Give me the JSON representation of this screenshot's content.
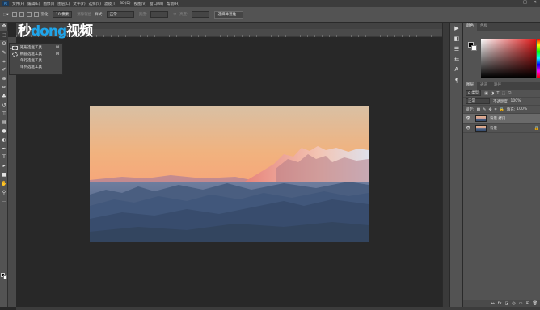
{
  "menubar": {
    "logo": "Ps",
    "items": [
      "文件(F)",
      "编辑(E)",
      "图像(I)",
      "图层(L)",
      "文字(Y)",
      "选择(S)",
      "滤镜(T)",
      "3D(D)",
      "视图(V)",
      "窗口(W)",
      "帮助(H)"
    ],
    "window_controls": [
      "—",
      "□",
      "✕"
    ]
  },
  "options_bar": {
    "feather_label": "羽化:",
    "feather_value": "10 像素",
    "antialias_label": "消除锯齿",
    "style_label": "样式:",
    "style_value": "正常",
    "width_label": "宽度:",
    "height_label": "高度:",
    "select_mask_button": "选择并遮住..."
  },
  "watermark": {
    "part1": "秒",
    "part2": "dong",
    "part3": "视频"
  },
  "flyout": {
    "items": [
      {
        "label": "矩形选框工具",
        "key": "M"
      },
      {
        "label": "椭圆选框工具",
        "key": "M"
      },
      {
        "label": "单行选框工具",
        "key": ""
      },
      {
        "label": "单列选框工具",
        "key": ""
      }
    ]
  },
  "toolbar": {
    "icons": [
      "move-icon",
      "marquee-icon",
      "lasso-icon",
      "quick-select-icon",
      "crop-icon",
      "eyedropper-icon",
      "healing-icon",
      "brush-icon",
      "stamp-icon",
      "history-brush-icon",
      "eraser-icon",
      "gradient-icon",
      "blur-icon",
      "dodge-icon",
      "pen-icon",
      "type-icon",
      "path-select-icon",
      "shape-icon",
      "hand-icon",
      "zoom-icon",
      "more-icon"
    ],
    "glyphs": [
      "✥",
      "⬚",
      "ʘ",
      "✎",
      "⌗",
      "✐",
      "⊕",
      "✏",
      "♣",
      "↺",
      "◫",
      "▤",
      "●",
      "◐",
      "✒",
      "T",
      "▸",
      "■",
      "✋",
      "⚲",
      "…"
    ]
  },
  "color_panel": {
    "tabs": [
      "颜色",
      "色板"
    ]
  },
  "layers_panel": {
    "tabs": [
      "图层",
      "通道",
      "路径"
    ],
    "filter_label": "ρ 类型",
    "blend_mode": "正常",
    "opacity_label": "不透明度:",
    "opacity_value": "100%",
    "lock_label": "锁定:",
    "fill_label": "填充:",
    "fill_value": "100%",
    "layers": [
      {
        "name": "背景 拷贝",
        "selected": true,
        "locked": false
      },
      {
        "name": "背景",
        "selected": false,
        "locked": true
      }
    ],
    "footer_icons": [
      "⇔",
      "fx",
      "◪",
      "◎",
      "▭",
      "⊞",
      "🗑"
    ]
  },
  "dock": {
    "glyphs": [
      "▶",
      "◧",
      "☰",
      "⇆",
      "Ꭺ",
      "¶"
    ]
  }
}
